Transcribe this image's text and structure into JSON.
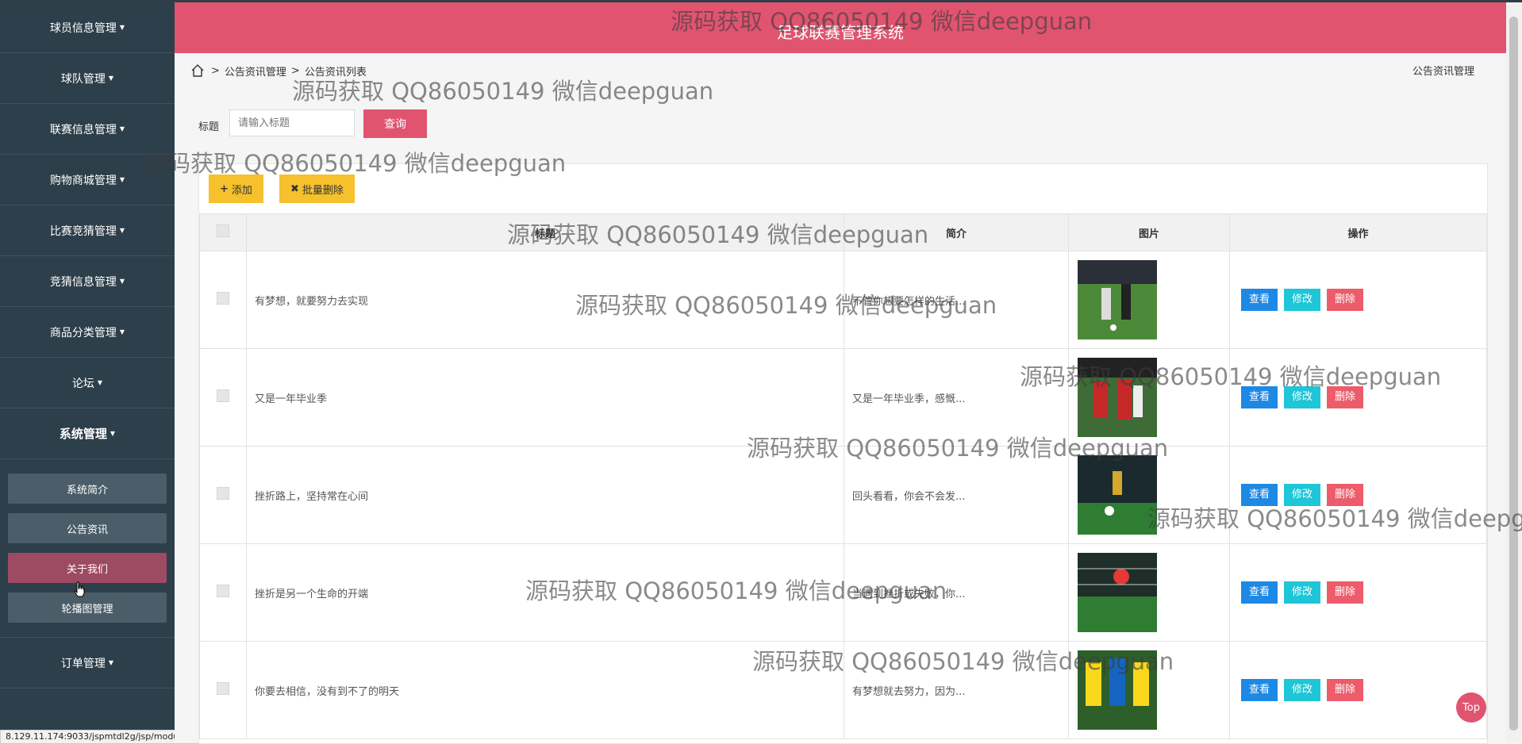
{
  "app": {
    "title": "足球联赛管理系统"
  },
  "sidebar": {
    "items": [
      {
        "label": "球员信息管理"
      },
      {
        "label": "球队管理"
      },
      {
        "label": "联赛信息管理"
      },
      {
        "label": "购物商城管理"
      },
      {
        "label": "比赛竞猜管理"
      },
      {
        "label": "竞猜信息管理"
      },
      {
        "label": "商品分类管理"
      },
      {
        "label": "论坛"
      },
      {
        "label": "系统管理"
      }
    ],
    "submenu": [
      {
        "label": "系统简介"
      },
      {
        "label": "公告资讯"
      },
      {
        "label": "关于我们"
      },
      {
        "label": "轮播图管理"
      }
    ],
    "last_item": "订单管理"
  },
  "breadcrumb": {
    "home_icon": "home-icon",
    "level1": "公告资讯管理",
    "level2": "公告资讯列表",
    "right": "公告资讯管理"
  },
  "search": {
    "label": "标题",
    "placeholder": "请输入标题",
    "button": "查询"
  },
  "toolbar": {
    "add": "添加",
    "batch_delete": "批量删除"
  },
  "table": {
    "headers": {
      "title": "标题",
      "summary": "简介",
      "image": "图片",
      "actions": "操作"
    },
    "rows": [
      {
        "title": "有梦想，就要努力去实现",
        "summary": "不管你想要怎样的生活..."
      },
      {
        "title": "又是一年毕业季",
        "summary": "又是一年毕业季，感慨..."
      },
      {
        "title": "挫折路上，坚持常在心间",
        "summary": "回头看看，你会不会发..."
      },
      {
        "title": "挫折是另一个生命的开端",
        "summary": "当遇到挫折或失败，你..."
      },
      {
        "title": "你要去相信，没有到不了的明天",
        "summary": "有梦想就去努力，因为..."
      }
    ],
    "actions": {
      "view": "查看",
      "edit": "修改",
      "delete": "删除"
    }
  },
  "top_button": "Top",
  "status_url": "8.129.11.174:9033/jspmtdl2g/jsp/modules/aboutus/list.jsp",
  "watermark": "源码获取 QQ86050149 微信deepguan",
  "colors": {
    "header": "#e15470",
    "sidebar": "#2d3f4a",
    "active_sub": "#9d4a63",
    "tool": "#f6c12c"
  }
}
